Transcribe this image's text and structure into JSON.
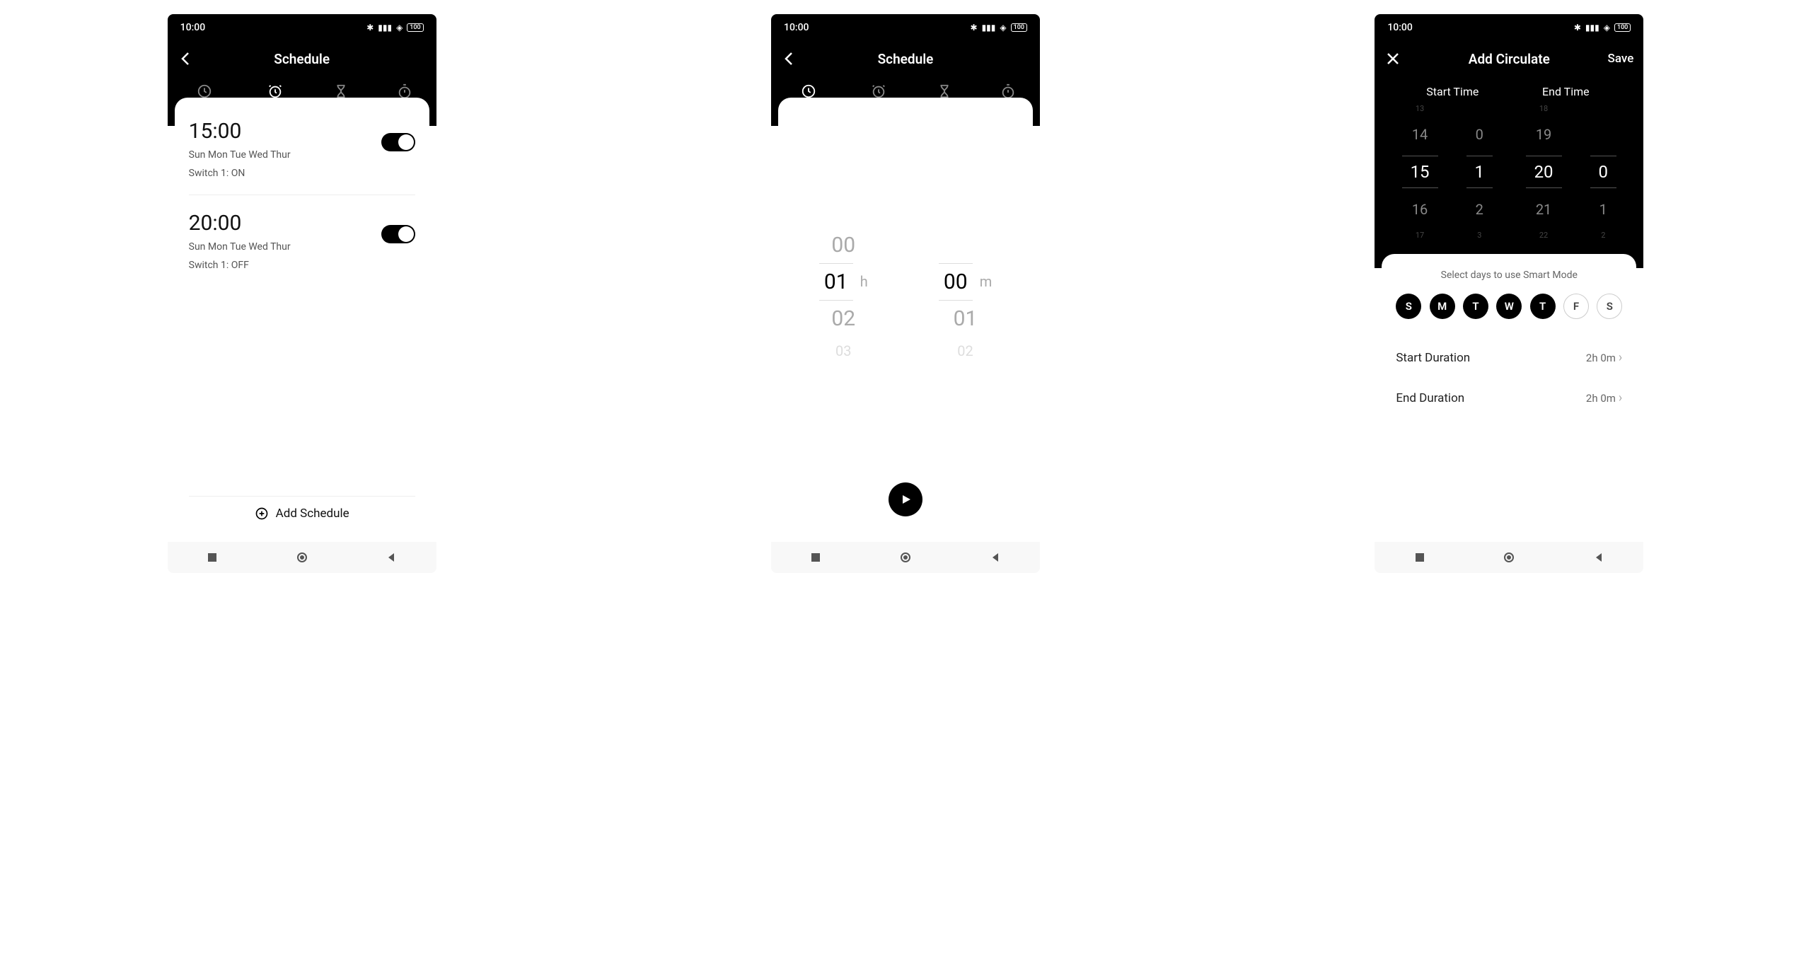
{
  "status": {
    "time": "10:00",
    "battery": "100"
  },
  "screen1": {
    "title": "Schedule",
    "tabs": [
      {
        "label": "Countdown"
      },
      {
        "label": "Schedule"
      },
      {
        "label": "Circulate"
      },
      {
        "label": "Random"
      }
    ],
    "schedules": [
      {
        "time": "15:00",
        "days": "Sun Mon Tue Wed Thur",
        "status": "Switch 1: ON"
      },
      {
        "time": "20:00",
        "days": "Sun Mon Tue Wed Thur",
        "status": "Switch 1: OFF"
      }
    ],
    "add_label": "Add Schedule"
  },
  "screen2": {
    "title": "Schedule",
    "tabs": [
      {
        "label": "Countdown"
      },
      {
        "label": "Schedule"
      },
      {
        "label": "Circulate"
      },
      {
        "label": "Random"
      }
    ],
    "hours": {
      "prev": "00",
      "sel": "01",
      "next": "02",
      "next2": "03",
      "unit": "h"
    },
    "mins": {
      "sel": "00",
      "next": "01",
      "next2": "02",
      "unit": "m"
    }
  },
  "screen3": {
    "title": "Add Circulate",
    "save": "Save",
    "start_label": "Start Time",
    "end_label": "End Time",
    "start": {
      "h_p2": "13",
      "h_prev": "14",
      "h_sel": "15",
      "h_next": "16",
      "h_n2": "17",
      "m_prev": "0",
      "m_sel": "1",
      "m_next": "2",
      "m_n2": "3"
    },
    "end": {
      "h_p2": "18",
      "h_prev": "19",
      "h_sel": "20",
      "h_next": "21",
      "h_n2": "22",
      "m_prev": "",
      "m_sel": "0",
      "m_next": "1",
      "m_n2": "2"
    },
    "smart_label": "Select days to use Smart Mode",
    "days": [
      {
        "l": "S",
        "on": true
      },
      {
        "l": "M",
        "on": true
      },
      {
        "l": "T",
        "on": true
      },
      {
        "l": "W",
        "on": true
      },
      {
        "l": "T",
        "on": true
      },
      {
        "l": "F",
        "on": false
      },
      {
        "l": "S",
        "on": false
      }
    ],
    "start_dur_label": "Start Duration",
    "start_dur_val": "2h 0m",
    "end_dur_label": "End Duration",
    "end_dur_val": "2h 0m"
  }
}
